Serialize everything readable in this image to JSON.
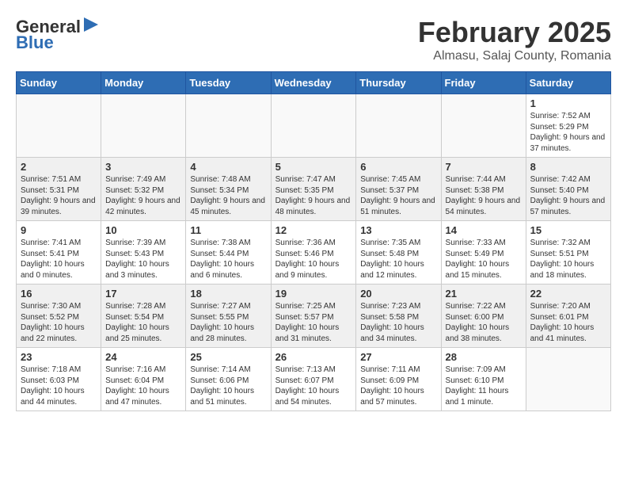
{
  "header": {
    "logo_general": "General",
    "logo_blue": "Blue",
    "month": "February 2025",
    "location": "Almasu, Salaj County, Romania"
  },
  "days_of_week": [
    "Sunday",
    "Monday",
    "Tuesday",
    "Wednesday",
    "Thursday",
    "Friday",
    "Saturday"
  ],
  "weeks": [
    [
      {
        "day": "",
        "detail": ""
      },
      {
        "day": "",
        "detail": ""
      },
      {
        "day": "",
        "detail": ""
      },
      {
        "day": "",
        "detail": ""
      },
      {
        "day": "",
        "detail": ""
      },
      {
        "day": "",
        "detail": ""
      },
      {
        "day": "1",
        "detail": "Sunrise: 7:52 AM\nSunset: 5:29 PM\nDaylight: 9 hours\nand 37 minutes."
      }
    ],
    [
      {
        "day": "2",
        "detail": "Sunrise: 7:51 AM\nSunset: 5:31 PM\nDaylight: 9 hours\nand 39 minutes."
      },
      {
        "day": "3",
        "detail": "Sunrise: 7:49 AM\nSunset: 5:32 PM\nDaylight: 9 hours\nand 42 minutes."
      },
      {
        "day": "4",
        "detail": "Sunrise: 7:48 AM\nSunset: 5:34 PM\nDaylight: 9 hours\nand 45 minutes."
      },
      {
        "day": "5",
        "detail": "Sunrise: 7:47 AM\nSunset: 5:35 PM\nDaylight: 9 hours\nand 48 minutes."
      },
      {
        "day": "6",
        "detail": "Sunrise: 7:45 AM\nSunset: 5:37 PM\nDaylight: 9 hours\nand 51 minutes."
      },
      {
        "day": "7",
        "detail": "Sunrise: 7:44 AM\nSunset: 5:38 PM\nDaylight: 9 hours\nand 54 minutes."
      },
      {
        "day": "8",
        "detail": "Sunrise: 7:42 AM\nSunset: 5:40 PM\nDaylight: 9 hours\nand 57 minutes."
      }
    ],
    [
      {
        "day": "9",
        "detail": "Sunrise: 7:41 AM\nSunset: 5:41 PM\nDaylight: 10 hours\nand 0 minutes."
      },
      {
        "day": "10",
        "detail": "Sunrise: 7:39 AM\nSunset: 5:43 PM\nDaylight: 10 hours\nand 3 minutes."
      },
      {
        "day": "11",
        "detail": "Sunrise: 7:38 AM\nSunset: 5:44 PM\nDaylight: 10 hours\nand 6 minutes."
      },
      {
        "day": "12",
        "detail": "Sunrise: 7:36 AM\nSunset: 5:46 PM\nDaylight: 10 hours\nand 9 minutes."
      },
      {
        "day": "13",
        "detail": "Sunrise: 7:35 AM\nSunset: 5:48 PM\nDaylight: 10 hours\nand 12 minutes."
      },
      {
        "day": "14",
        "detail": "Sunrise: 7:33 AM\nSunset: 5:49 PM\nDaylight: 10 hours\nand 15 minutes."
      },
      {
        "day": "15",
        "detail": "Sunrise: 7:32 AM\nSunset: 5:51 PM\nDaylight: 10 hours\nand 18 minutes."
      }
    ],
    [
      {
        "day": "16",
        "detail": "Sunrise: 7:30 AM\nSunset: 5:52 PM\nDaylight: 10 hours\nand 22 minutes."
      },
      {
        "day": "17",
        "detail": "Sunrise: 7:28 AM\nSunset: 5:54 PM\nDaylight: 10 hours\nand 25 minutes."
      },
      {
        "day": "18",
        "detail": "Sunrise: 7:27 AM\nSunset: 5:55 PM\nDaylight: 10 hours\nand 28 minutes."
      },
      {
        "day": "19",
        "detail": "Sunrise: 7:25 AM\nSunset: 5:57 PM\nDaylight: 10 hours\nand 31 minutes."
      },
      {
        "day": "20",
        "detail": "Sunrise: 7:23 AM\nSunset: 5:58 PM\nDaylight: 10 hours\nand 34 minutes."
      },
      {
        "day": "21",
        "detail": "Sunrise: 7:22 AM\nSunset: 6:00 PM\nDaylight: 10 hours\nand 38 minutes."
      },
      {
        "day": "22",
        "detail": "Sunrise: 7:20 AM\nSunset: 6:01 PM\nDaylight: 10 hours\nand 41 minutes."
      }
    ],
    [
      {
        "day": "23",
        "detail": "Sunrise: 7:18 AM\nSunset: 6:03 PM\nDaylight: 10 hours\nand 44 minutes."
      },
      {
        "day": "24",
        "detail": "Sunrise: 7:16 AM\nSunset: 6:04 PM\nDaylight: 10 hours\nand 47 minutes."
      },
      {
        "day": "25",
        "detail": "Sunrise: 7:14 AM\nSunset: 6:06 PM\nDaylight: 10 hours\nand 51 minutes."
      },
      {
        "day": "26",
        "detail": "Sunrise: 7:13 AM\nSunset: 6:07 PM\nDaylight: 10 hours\nand 54 minutes."
      },
      {
        "day": "27",
        "detail": "Sunrise: 7:11 AM\nSunset: 6:09 PM\nDaylight: 10 hours\nand 57 minutes."
      },
      {
        "day": "28",
        "detail": "Sunrise: 7:09 AM\nSunset: 6:10 PM\nDaylight: 11 hours\nand 1 minute."
      },
      {
        "day": "",
        "detail": ""
      }
    ]
  ]
}
